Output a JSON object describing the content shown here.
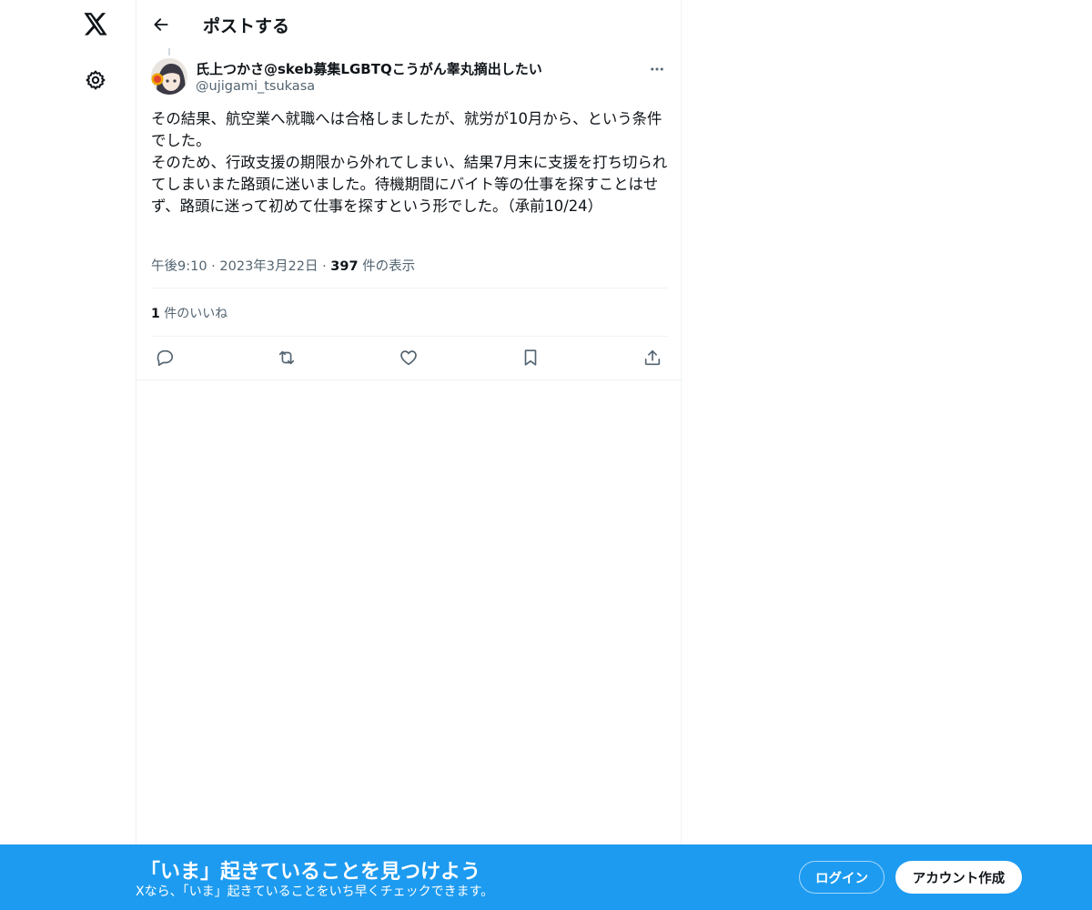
{
  "nav": {
    "logo_icon": "x-logo-icon",
    "settings_icon": "gear-icon"
  },
  "header": {
    "back_icon": "arrow-left-icon",
    "title": "ポストする"
  },
  "post": {
    "author_name": "氏上つかさ@skeb募集LGBTQこうがん睾丸摘出したい",
    "author_handle": "@ujigami_tsukasa",
    "more_icon": "ellipsis-icon",
    "text": "その結果、航空業へ就職へは合格しましたが、就労が10月から、という条件でした。\nそのため、行政支援の期限から外れてしまい、結果7月末に支援を打ち切られてしまいまた路頭に迷いました。待機期間にバイト等の仕事を探すことはせず、路頭に迷って初めて仕事を探すという形でした。（承前10/24）",
    "time": "午後9:10",
    "date": "2023年3月22日",
    "separator": "·",
    "views_count": "397",
    "views_label": "件の表示",
    "likes_count": "1",
    "likes_label": "件のいいね"
  },
  "actions": [
    {
      "name": "reply",
      "icon": "reply-icon"
    },
    {
      "name": "repost",
      "icon": "repost-icon"
    },
    {
      "name": "like",
      "icon": "heart-icon"
    },
    {
      "name": "bookmark",
      "icon": "bookmark-icon"
    },
    {
      "name": "share",
      "icon": "share-icon"
    }
  ],
  "banner": {
    "title": "「いま」起きていることを見つけよう",
    "subtitle": "Xなら、「いま」起きていることをいち早くチェックできます。",
    "login_label": "ログイン",
    "signup_label": "アカウント作成"
  },
  "colors": {
    "accent": "#1d9bf0",
    "text": "#0f1419",
    "secondary": "#536471",
    "border": "#eff3f4"
  }
}
